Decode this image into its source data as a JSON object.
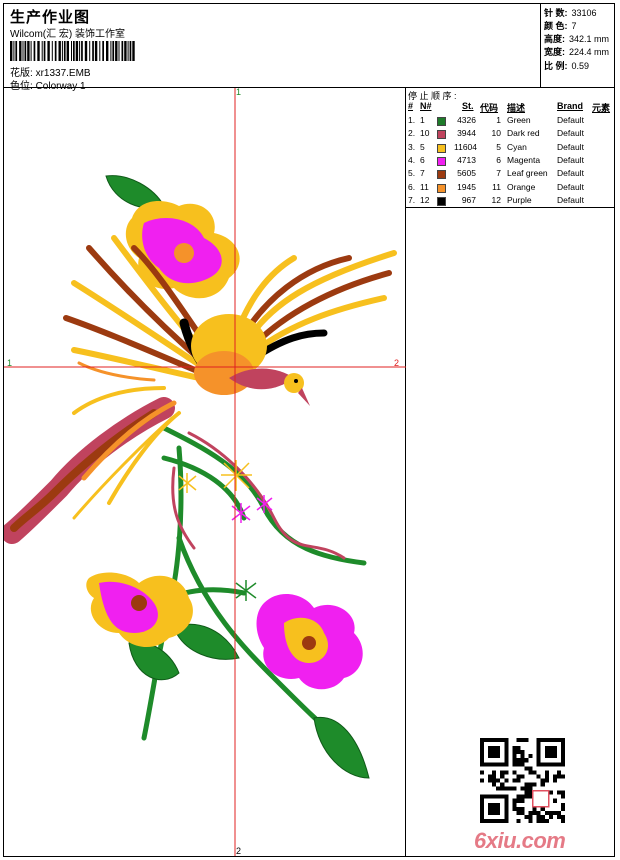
{
  "header": {
    "title": "生产作业图",
    "company": "Wilcom(汇 宏) 装饰工作室",
    "design_label": "花版:",
    "design_value": "xr1337.EMB",
    "colorway_label": "色位:",
    "colorway_value": "Colorway 1"
  },
  "stats": {
    "stitches_label": "针 数:",
    "stitches_value": "33106",
    "colors_label": "颜 色:",
    "colors_value": "7",
    "height_label": "高度:",
    "height_value": "342.1 mm",
    "width_label": "宽度:",
    "width_value": "224.4 mm",
    "scale_label": "比 例:",
    "scale_value": "0.59"
  },
  "axis": {
    "left": "1",
    "right": "2",
    "top": "1",
    "bottom": "2"
  },
  "sequence": {
    "title": "停 止 顺 序 :",
    "headers": {
      "num": "#",
      "n": "N#",
      "st": "St.",
      "code": "代码",
      "desc": "描述",
      "brand": "Brand",
      "elem": "元素"
    },
    "rows": [
      {
        "idx": "1.",
        "n": "1",
        "color": "#1e7b2a",
        "st": "4326",
        "code": "1",
        "desc": "Green",
        "brand": "Default"
      },
      {
        "idx": "2.",
        "n": "10",
        "color": "#c0435e",
        "st": "3944",
        "code": "10",
        "desc": "Dark red",
        "brand": "Default"
      },
      {
        "idx": "3.",
        "n": "5",
        "color": "#f7c01e",
        "st": "11604",
        "code": "5",
        "desc": "Cyan",
        "brand": "Default"
      },
      {
        "idx": "4.",
        "n": "6",
        "color": "#f020f0",
        "st": "4713",
        "code": "6",
        "desc": "Magenta",
        "brand": "Default"
      },
      {
        "idx": "5.",
        "n": "7",
        "color": "#9c3a10",
        "st": "5605",
        "code": "7",
        "desc": "Leaf green",
        "brand": "Default"
      },
      {
        "idx": "6.",
        "n": "11",
        "color": "#f5922a",
        "st": "1945",
        "code": "11",
        "desc": "Orange",
        "brand": "Default"
      },
      {
        "idx": "7.",
        "n": "12",
        "color": "#000000",
        "st": "967",
        "code": "12",
        "desc": "Purple",
        "brand": "Default"
      }
    ]
  },
  "logo_text": "6xiu.com",
  "colors": {
    "axis": "#e02020",
    "green": "#1e8b2a",
    "yellow": "#f7c01e",
    "magenta": "#f020f0",
    "brown": "#9c3a10",
    "orange": "#f5922a",
    "darkred": "#c0435e"
  }
}
